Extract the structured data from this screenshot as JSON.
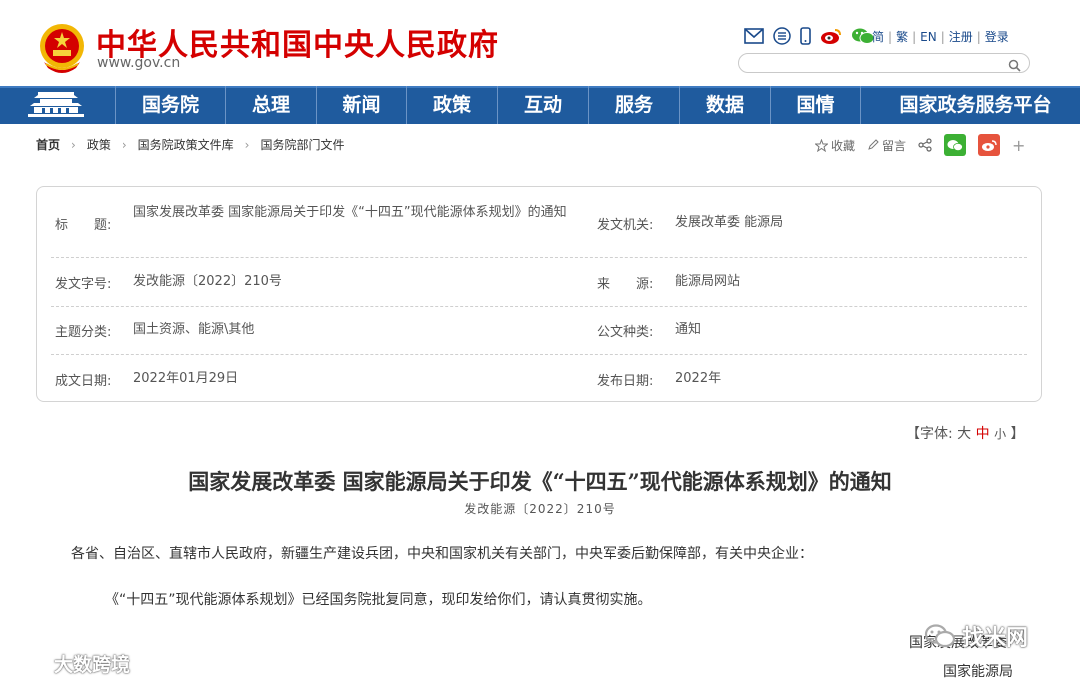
{
  "header": {
    "title": "中华人民共和国中央人民政府",
    "url": "www.gov.cn",
    "icons": [
      "mail-icon",
      "rss-icon",
      "mobile-icon",
      "weibo-icon",
      "wechat-icon"
    ],
    "lang_links": [
      "简",
      "繁",
      "EN"
    ],
    "register": "注册",
    "login": "登录",
    "search_placeholder": ""
  },
  "nav": {
    "items": [
      "国务院",
      "总理",
      "新闻",
      "政策",
      "互动",
      "服务",
      "数据",
      "国情",
      "国家政务服务平台"
    ]
  },
  "breadcrumb": {
    "items": [
      "首页",
      "政策",
      "国务院政策文件库",
      "国务院部门文件"
    ]
  },
  "tools": {
    "favorite": "收藏",
    "comment": "留言",
    "plus": "+"
  },
  "info": {
    "title_label": "标　　题:",
    "title_value": "国家发展改革委 国家能源局关于印发《“十四五”现代能源体系规划》的通知",
    "issuer_label": "发文机关:",
    "issuer_value": "发展改革委 能源局",
    "docno_label": "发文字号:",
    "docno_value": "发改能源〔2022〕210号",
    "source_label": "来　　源:",
    "source_value": "能源局网站",
    "topic_label": "主题分类:",
    "topic_value": "国土资源、能源\\其他",
    "type_label": "公文种类:",
    "type_value": "通知",
    "created_label": "成文日期:",
    "created_value": "2022年01月29日",
    "published_label": "发布日期:",
    "published_value": "2022年"
  },
  "fontsize": {
    "prefix": "【字体:",
    "large": "大",
    "medium": "中",
    "small": "小",
    "suffix": "】"
  },
  "doc": {
    "title": "国家发展改革委 国家能源局关于印发《“十四五”现代能源体系规划》的通知",
    "number": "发改能源〔2022〕210号",
    "para1": "各省、自治区、直辖市人民政府，新疆生产建设兵团，中央和国家机关有关部门，中央军委后勤保障部，有关中央企业：",
    "para2": "《“十四五”现代能源体系规划》已经国务院批复同意，现印发给你们，请认真贯彻实施。",
    "sign1": "国家发展改革委",
    "sign2": "国家能源局"
  },
  "watermarks": {
    "left": "大数跨境",
    "right": "找米网"
  },
  "colors": {
    "brand_red": "#d40000",
    "nav_blue": "#1f5b9e",
    "link_blue": "#1a4a8b",
    "wechat_green": "#3cb034",
    "weibo_red": "#e6533d"
  }
}
